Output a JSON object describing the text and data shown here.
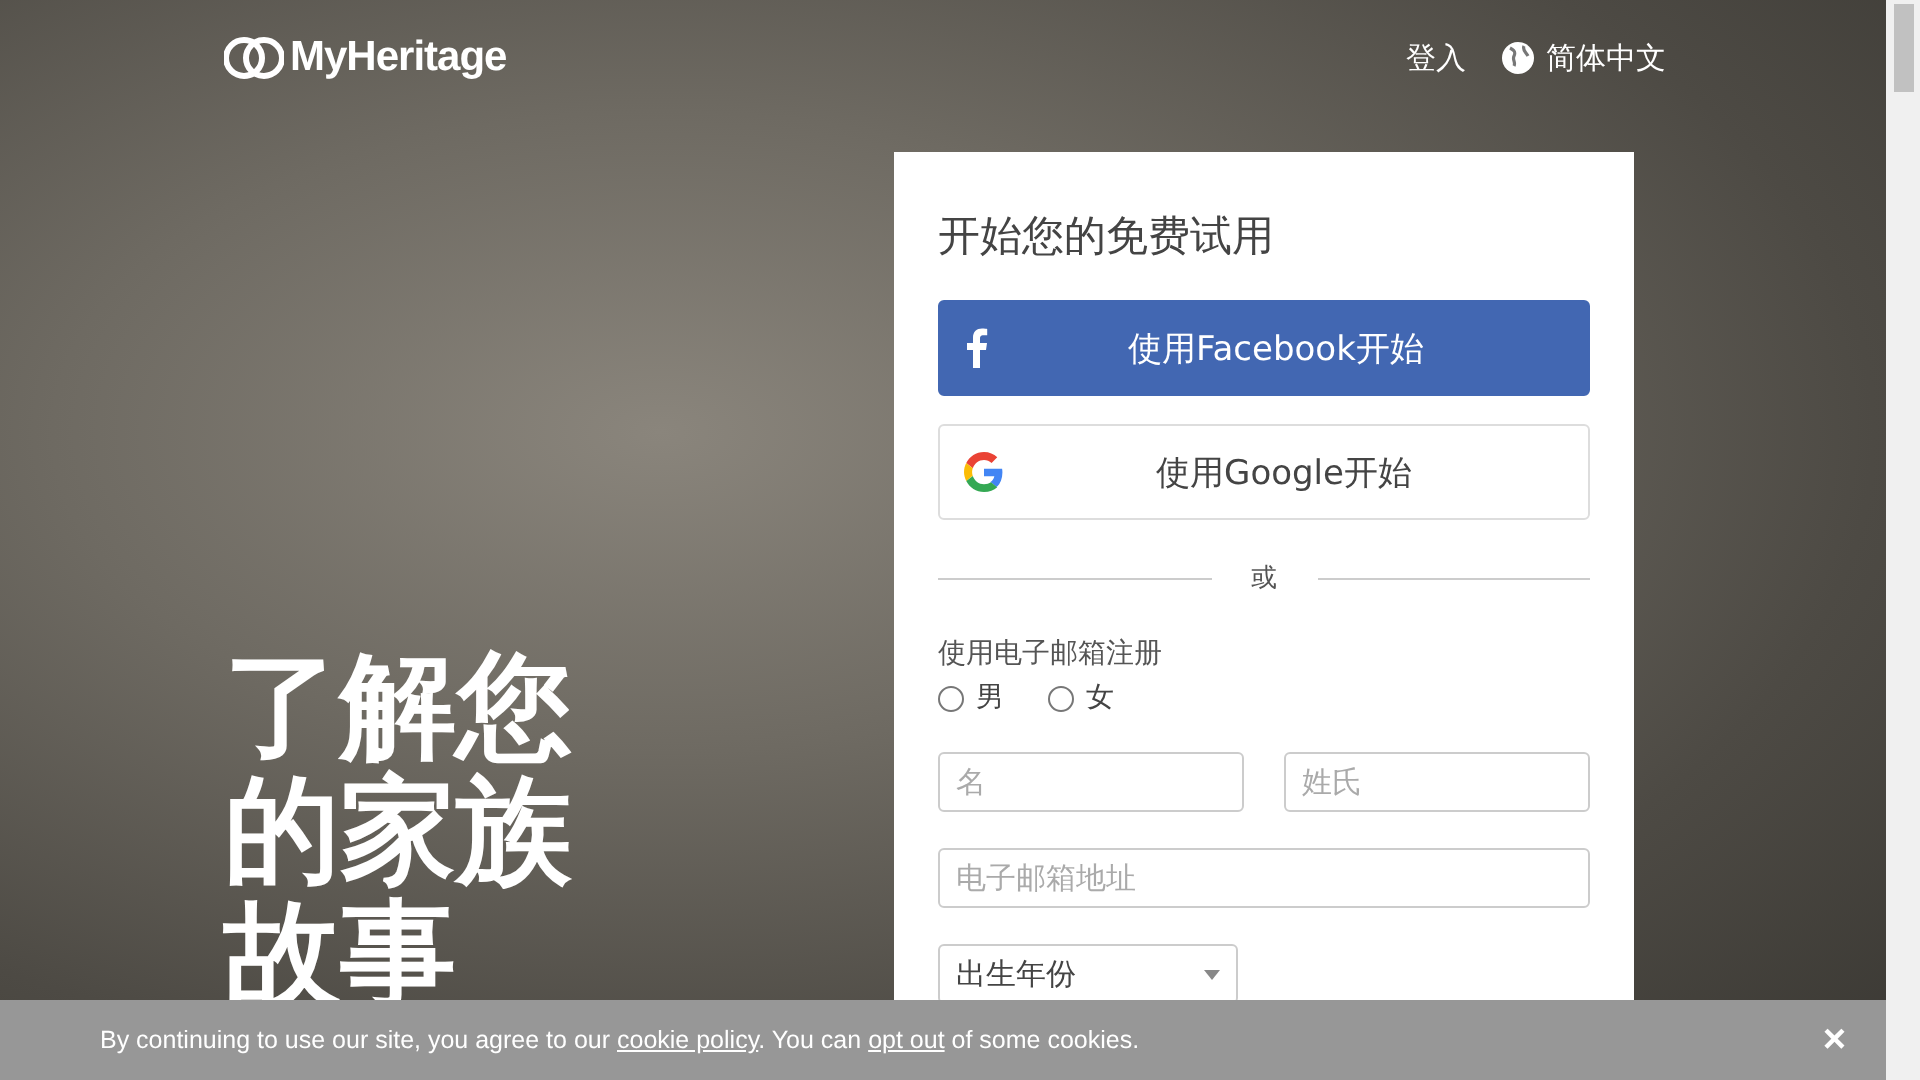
{
  "header": {
    "logo": "MyHeritage",
    "login": "登入",
    "language": "简体中文"
  },
  "hero": {
    "headline_lines": [
      "了解您",
      "的家族",
      "故事"
    ]
  },
  "signup": {
    "title": "开始您的免费试用",
    "social_buttons": [
      {
        "kind": "facebook",
        "label": "使用Facebook开始"
      },
      {
        "kind": "google",
        "label": "使用Google开始"
      }
    ],
    "divider": "或",
    "email_heading": "使用电子邮箱注册",
    "gender": [
      {
        "label": "男",
        "selected": false
      },
      {
        "label": "女",
        "selected": false
      }
    ],
    "first_name": {
      "placeholder": "名"
    },
    "last_name": {
      "placeholder": "姓氏"
    },
    "email": {
      "placeholder": "电子邮箱地址"
    },
    "birth_year": {
      "placeholder": "出生年份"
    }
  },
  "cookie_bar": {
    "before": "By continuing to use our site, you agree to our ",
    "policy_link": "cookie policy",
    "middle": ". You can ",
    "opt_out_link": "opt out",
    "after": " of some cookies.",
    "close": "×"
  }
}
